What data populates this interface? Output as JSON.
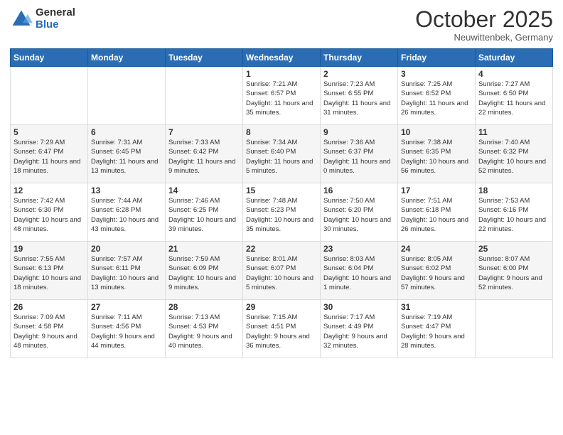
{
  "header": {
    "logo_line1": "General",
    "logo_line2": "Blue",
    "month": "October 2025",
    "location": "Neuwittenbek, Germany"
  },
  "weekdays": [
    "Sunday",
    "Monday",
    "Tuesday",
    "Wednesday",
    "Thursday",
    "Friday",
    "Saturday"
  ],
  "weeks": [
    [
      {
        "day": "",
        "info": ""
      },
      {
        "day": "",
        "info": ""
      },
      {
        "day": "",
        "info": ""
      },
      {
        "day": "1",
        "info": "Sunrise: 7:21 AM\nSunset: 6:57 PM\nDaylight: 11 hours and 35 minutes."
      },
      {
        "day": "2",
        "info": "Sunrise: 7:23 AM\nSunset: 6:55 PM\nDaylight: 11 hours and 31 minutes."
      },
      {
        "day": "3",
        "info": "Sunrise: 7:25 AM\nSunset: 6:52 PM\nDaylight: 11 hours and 26 minutes."
      },
      {
        "day": "4",
        "info": "Sunrise: 7:27 AM\nSunset: 6:50 PM\nDaylight: 11 hours and 22 minutes."
      }
    ],
    [
      {
        "day": "5",
        "info": "Sunrise: 7:29 AM\nSunset: 6:47 PM\nDaylight: 11 hours and 18 minutes."
      },
      {
        "day": "6",
        "info": "Sunrise: 7:31 AM\nSunset: 6:45 PM\nDaylight: 11 hours and 13 minutes."
      },
      {
        "day": "7",
        "info": "Sunrise: 7:33 AM\nSunset: 6:42 PM\nDaylight: 11 hours and 9 minutes."
      },
      {
        "day": "8",
        "info": "Sunrise: 7:34 AM\nSunset: 6:40 PM\nDaylight: 11 hours and 5 minutes."
      },
      {
        "day": "9",
        "info": "Sunrise: 7:36 AM\nSunset: 6:37 PM\nDaylight: 11 hours and 0 minutes."
      },
      {
        "day": "10",
        "info": "Sunrise: 7:38 AM\nSunset: 6:35 PM\nDaylight: 10 hours and 56 minutes."
      },
      {
        "day": "11",
        "info": "Sunrise: 7:40 AM\nSunset: 6:32 PM\nDaylight: 10 hours and 52 minutes."
      }
    ],
    [
      {
        "day": "12",
        "info": "Sunrise: 7:42 AM\nSunset: 6:30 PM\nDaylight: 10 hours and 48 minutes."
      },
      {
        "day": "13",
        "info": "Sunrise: 7:44 AM\nSunset: 6:28 PM\nDaylight: 10 hours and 43 minutes."
      },
      {
        "day": "14",
        "info": "Sunrise: 7:46 AM\nSunset: 6:25 PM\nDaylight: 10 hours and 39 minutes."
      },
      {
        "day": "15",
        "info": "Sunrise: 7:48 AM\nSunset: 6:23 PM\nDaylight: 10 hours and 35 minutes."
      },
      {
        "day": "16",
        "info": "Sunrise: 7:50 AM\nSunset: 6:20 PM\nDaylight: 10 hours and 30 minutes."
      },
      {
        "day": "17",
        "info": "Sunrise: 7:51 AM\nSunset: 6:18 PM\nDaylight: 10 hours and 26 minutes."
      },
      {
        "day": "18",
        "info": "Sunrise: 7:53 AM\nSunset: 6:16 PM\nDaylight: 10 hours and 22 minutes."
      }
    ],
    [
      {
        "day": "19",
        "info": "Sunrise: 7:55 AM\nSunset: 6:13 PM\nDaylight: 10 hours and 18 minutes."
      },
      {
        "day": "20",
        "info": "Sunrise: 7:57 AM\nSunset: 6:11 PM\nDaylight: 10 hours and 13 minutes."
      },
      {
        "day": "21",
        "info": "Sunrise: 7:59 AM\nSunset: 6:09 PM\nDaylight: 10 hours and 9 minutes."
      },
      {
        "day": "22",
        "info": "Sunrise: 8:01 AM\nSunset: 6:07 PM\nDaylight: 10 hours and 5 minutes."
      },
      {
        "day": "23",
        "info": "Sunrise: 8:03 AM\nSunset: 6:04 PM\nDaylight: 10 hours and 1 minute."
      },
      {
        "day": "24",
        "info": "Sunrise: 8:05 AM\nSunset: 6:02 PM\nDaylight: 9 hours and 57 minutes."
      },
      {
        "day": "25",
        "info": "Sunrise: 8:07 AM\nSunset: 6:00 PM\nDaylight: 9 hours and 52 minutes."
      }
    ],
    [
      {
        "day": "26",
        "info": "Sunrise: 7:09 AM\nSunset: 4:58 PM\nDaylight: 9 hours and 48 minutes."
      },
      {
        "day": "27",
        "info": "Sunrise: 7:11 AM\nSunset: 4:56 PM\nDaylight: 9 hours and 44 minutes."
      },
      {
        "day": "28",
        "info": "Sunrise: 7:13 AM\nSunset: 4:53 PM\nDaylight: 9 hours and 40 minutes."
      },
      {
        "day": "29",
        "info": "Sunrise: 7:15 AM\nSunset: 4:51 PM\nDaylight: 9 hours and 36 minutes."
      },
      {
        "day": "30",
        "info": "Sunrise: 7:17 AM\nSunset: 4:49 PM\nDaylight: 9 hours and 32 minutes."
      },
      {
        "day": "31",
        "info": "Sunrise: 7:19 AM\nSunset: 4:47 PM\nDaylight: 9 hours and 28 minutes."
      },
      {
        "day": "",
        "info": ""
      }
    ]
  ]
}
